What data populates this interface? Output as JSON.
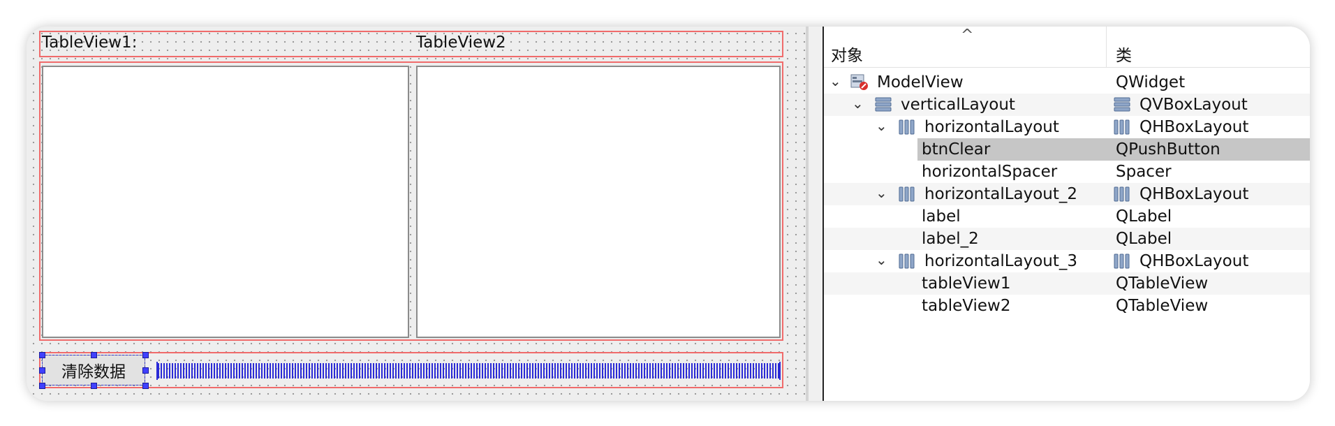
{
  "canvas": {
    "label1": "TableView1:",
    "label2": "TableView2",
    "clear_button": "清除数据"
  },
  "inspector": {
    "header_object": "对象",
    "header_class": "类",
    "sort_indicator": "^",
    "rows": [
      {
        "name": "ModelView",
        "cls": "QWidget",
        "icon": "widget-icon",
        "expanded": true
      },
      {
        "name": "verticalLayout",
        "cls": "QVBoxLayout",
        "icon": "vbox-layout-icon",
        "expanded": true
      },
      {
        "name": "horizontalLayout",
        "cls": "QHBoxLayout",
        "icon": "hbox-layout-icon",
        "expanded": true
      },
      {
        "name": "btnClear",
        "cls": "QPushButton",
        "selected": true
      },
      {
        "name": "horizontalSpacer",
        "cls": "Spacer"
      },
      {
        "name": "horizontalLayout_2",
        "cls": "QHBoxLayout",
        "icon": "hbox-layout-icon",
        "expanded": true
      },
      {
        "name": "label",
        "cls": "QLabel"
      },
      {
        "name": "label_2",
        "cls": "QLabel"
      },
      {
        "name": "horizontalLayout_3",
        "cls": "QHBoxLayout",
        "icon": "hbox-layout-icon",
        "expanded": true
      },
      {
        "name": "tableView1",
        "cls": "QTableView"
      },
      {
        "name": "tableView2",
        "cls": "QTableView"
      }
    ]
  },
  "colors": {
    "layout_frame": "#f06b6b",
    "selection_handle": "#4040ff",
    "spacer": "#2a2ad6",
    "selected_row": "#c6c6c6"
  }
}
